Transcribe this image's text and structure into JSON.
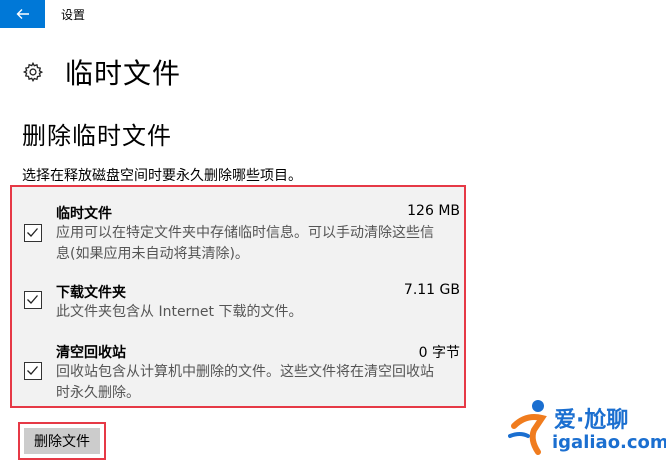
{
  "window": {
    "title": "设置"
  },
  "page": {
    "title": "临时文件",
    "section_title": "删除临时文件",
    "description": "选择在释放磁盘空间时要永久删除哪些项目。"
  },
  "items": [
    {
      "name": "临时文件",
      "size": "126 MB",
      "checked": true,
      "detail_line1": "应用可以在特定文件夹中存储临时信息。可以手动清除这些信",
      "detail_line2": "息(如果应用未自动将其清除)。"
    },
    {
      "name": "下载文件夹",
      "size": "7.11 GB",
      "checked": true,
      "detail_line1": "此文件夹包含从 Internet 下载的文件。",
      "detail_line2": ""
    },
    {
      "name": "清空回收站",
      "size": "0 字节",
      "checked": true,
      "detail_line1": "回收站包含从计算机中删除的文件。这些文件将在清空回收站",
      "detail_line2": "时永久删除。"
    }
  ],
  "actions": {
    "delete_label": "删除文件"
  },
  "watermark": {
    "cn": "爱·尬聊",
    "en": "igaliao.com"
  },
  "colors": {
    "accent": "#0078d7",
    "highlight_border": "#e63946",
    "list_bg": "#f2f2f2",
    "button_bg": "#cccccc"
  },
  "icons": {
    "back": "arrow-left-icon",
    "header": "gear-icon",
    "checkbox": "checkmark-icon"
  }
}
